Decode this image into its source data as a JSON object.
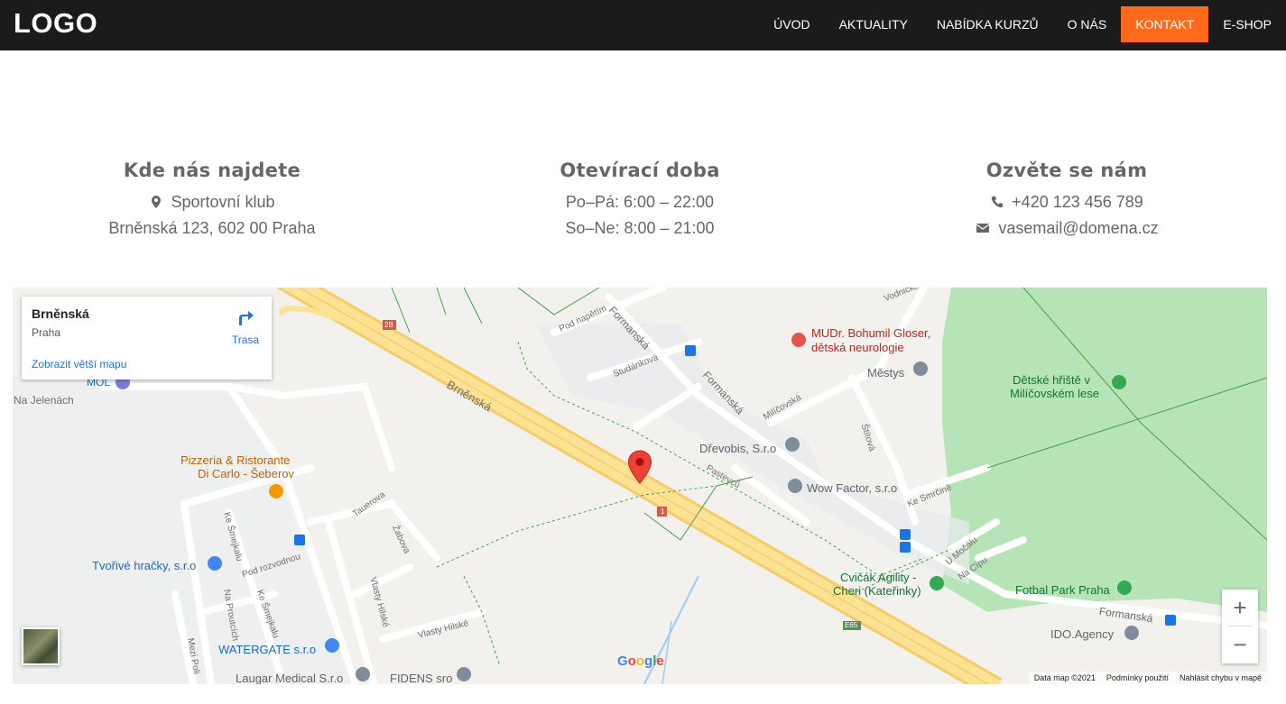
{
  "header": {
    "logo": "LOGO",
    "nav": [
      {
        "label": "ÚVOD"
      },
      {
        "label": "AKTUALITY"
      },
      {
        "label": "NABÍDKA KURZŮ"
      },
      {
        "label": "O NÁS"
      },
      {
        "label": "KONTAKT",
        "active": true
      },
      {
        "label": "E-SHOP"
      }
    ],
    "accent_color": "#ff6a1a"
  },
  "contact": {
    "location": {
      "title": "Kde nás najdete",
      "line1": "Sportovní klub",
      "line2": "Brněnská 123,  602 00 Praha",
      "icon": "map-marker-icon"
    },
    "hours": {
      "title": "Otevírací doba",
      "line1": "Po–Pá: 6:00 – 22:00",
      "line2": "So–Ne: 8:00 – 21:00"
    },
    "reach": {
      "title": "Ozvěte se nám",
      "phone": "+420 123 456 789",
      "email": "vasemail@domena.cz",
      "phone_icon": "phone-icon",
      "email_icon": "envelope-icon"
    }
  },
  "map": {
    "card": {
      "place": "Brněnská",
      "city": "Praha",
      "bigger_map": "Zobrazit větší mapu",
      "directions": "Trasa"
    },
    "pois": {
      "gloser1": "MUDr. Bohumil Gloser,",
      "gloser2": "dětská neurologie",
      "mestys": "Městys",
      "hriste1": "Dětské hřiště v",
      "hriste2": "Milíčovském lese",
      "drevobis": "Dřevobis, S.r.o",
      "wow": "Wow Factor, s.r.o",
      "pizzeria1": "Pizzeria & Ristorante",
      "pizzeria2": "Di Carlo - Šeberov",
      "tvorive": "Tvořivé hračky, s.r.o",
      "watergate": "WATERGATE s.r.o",
      "laugar": "Laugar Medical S.r.o",
      "fidens": "FIDENS sro",
      "cvicak1": "Cvičák Agility -",
      "cvicak2": "Cheri (Kateřinky)",
      "fotbal": "Fotbal Park Praha",
      "ido": "IDO.Agency",
      "mol": "MOL"
    },
    "streets": {
      "brnenska": "Brněnská",
      "formanska1": "Formanská",
      "formanska2": "Formanská",
      "formanska3": "Formanská",
      "studankova": "Studánková",
      "podnapetim": "Pod napětím",
      "milicovska": "Milíčovská",
      "pastevcu": "Pastevců",
      "stitova": "Štítová",
      "kesmrcine": "Ke Smrčině",
      "umocalu": "U Močálu",
      "nacipu": "Na Cípu",
      "najelenach": "Na Jelenách",
      "tauerova": "Tauerova",
      "zabova": "Žabova",
      "kesmejkalu1": "Ke Šmejkalu",
      "kesmejkalu2": "Ke Šmejkalu",
      "podrozvodnou": "Pod rozvodnou",
      "naproutcich": "Na Proutcích",
      "vlastyhilske1": "Vlasty Hilské",
      "vlastyhilske2": "Vlasty Hilské",
      "mezipoli": "Mezi Poli",
      "vodnicka": "Vodnická",
      "shield_2b": "2B",
      "shield_1": "1",
      "shield_e65": "E65"
    },
    "google": "Google",
    "zoom_in": "+",
    "zoom_out": "−",
    "footer": {
      "data": "Data map ©2021",
      "terms": "Podmínky použití",
      "report": "Nahlásit chybu v mapě"
    }
  }
}
